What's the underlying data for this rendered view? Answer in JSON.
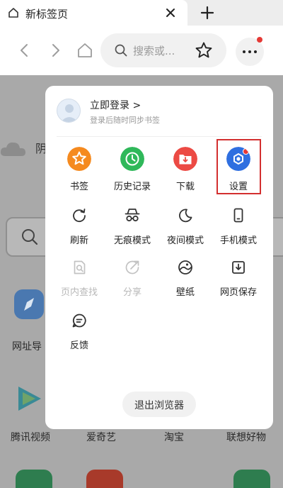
{
  "tab": {
    "title": "新标签页"
  },
  "toolbar": {
    "search_placeholder": "搜索或..."
  },
  "background": {
    "weather_text": "阴",
    "apps_row1": [
      {
        "label": "网址导"
      }
    ],
    "apps_row2": [
      {
        "label": "腾讯视频"
      },
      {
        "label": "爱奇艺"
      },
      {
        "label": "淘宝"
      },
      {
        "label": "联想好物"
      }
    ]
  },
  "menu": {
    "login_title": "立即登录 >",
    "login_subtitle": "登录后随时同步书签",
    "items": [
      {
        "label": "书签",
        "icon": "bookmark-star-icon",
        "color": "#f58a1f"
      },
      {
        "label": "历史记录",
        "icon": "history-clock-icon",
        "color": "#2fb85a"
      },
      {
        "label": "下载",
        "icon": "download-folder-icon",
        "color": "#ec4a44"
      },
      {
        "label": "设置",
        "icon": "settings-gear-icon",
        "color": "#2f6fe0"
      },
      {
        "label": "刷新",
        "icon": "refresh-icon"
      },
      {
        "label": "无痕模式",
        "icon": "incognito-icon"
      },
      {
        "label": "夜间模式",
        "icon": "night-moon-icon"
      },
      {
        "label": "手机模式",
        "icon": "phone-icon"
      },
      {
        "label": "页内查找",
        "icon": "find-in-page-icon",
        "disabled": true
      },
      {
        "label": "分享",
        "icon": "share-icon",
        "disabled": true
      },
      {
        "label": "壁纸",
        "icon": "wallpaper-icon"
      },
      {
        "label": "网页保存",
        "icon": "save-page-icon"
      },
      {
        "label": "反馈",
        "icon": "feedback-icon"
      }
    ],
    "exit_label": "退出浏览器"
  },
  "colors": {
    "highlight": "#d32f2f",
    "notification_dot": "#e53935"
  }
}
